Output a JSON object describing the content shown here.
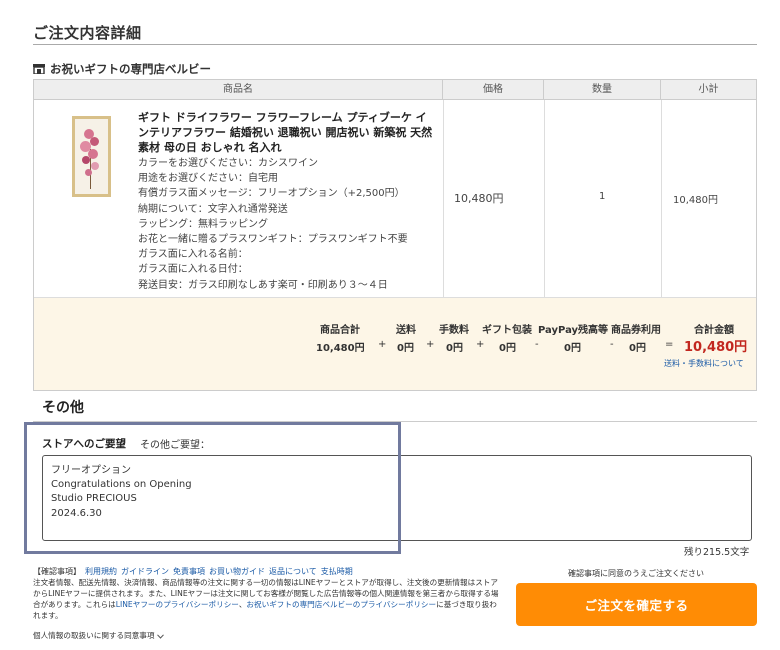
{
  "page": {
    "title": "ご注文内容詳細"
  },
  "store": {
    "name": "お祝いギフトの専門店ベルビー"
  },
  "table": {
    "headers": {
      "product": "商品名",
      "price": "価格",
      "qty": "数量",
      "subtotal": "小計"
    }
  },
  "item": {
    "name": "ギフト ドライフラワー フラワーフレーム プティブーケ インテリアフラワー 結婚祝い 退職祝い 開店祝い 新築祝 天然素材 母の日 おしゃれ 名入れ",
    "options": [
      "カラーをお選びください：カシスワイン",
      "用途をお選びください：自宅用",
      "有償ガラス面メッセージ：フリーオプション（+2,500円）",
      "納期について：文字入れ通常発送",
      "ラッピング：無料ラッピング",
      "お花と一緒に贈るプラスワンギフト：プラスワンギフト不要",
      "ガラス面に入れる名前：",
      "ガラス面に入れる日付：",
      "発送目安：ガラス印刷なしあす楽可・印刷あり３～４日"
    ],
    "price": "10,480円",
    "qty": "1",
    "subtotal": "10,480円"
  },
  "totals": {
    "labels": {
      "goods": "商品合計",
      "shipping": "送料",
      "fee": "手数料",
      "wrap": "ギフト包装",
      "paypay": "PayPay残高等",
      "coupon": "商品券利用",
      "total": "合計金額"
    },
    "values": {
      "goods": "10,480円",
      "shipping": "0円",
      "fee": "0円",
      "wrap": "0円",
      "paypay": "0円",
      "coupon": "0円",
      "total": "10,480円"
    },
    "ops": {
      "plus": "+",
      "minus": "-",
      "equals": "="
    },
    "fee_link": "送料・手数料について"
  },
  "other": {
    "title": "その他",
    "request_label": "ストアへのご要望",
    "request_sub": "その他ご要望：",
    "request_lines": [
      "フリーオプション",
      "Congratulations on Opening",
      "Studio PRECIOUS",
      "2024.6.30"
    ],
    "remaining": "残り215.5文字"
  },
  "notice": {
    "head": "【確認事項】",
    "links": [
      "利用規約",
      "ガイドライン",
      "免責事項",
      "お買い物ガイド",
      "返品について",
      "支払時期"
    ],
    "body_1": "注文者情報、配送先情報、決済情報、商品情報等の注文に関する一切の情報はLINEヤフーとストアが取得し、注文後の更新情報はストアからLINEヤフーに提供されます。また、LINEヤフーは注文に関してお客様が閲覧した広告情報等の個人関連情報を第三者から取得する場合があります。これらは",
    "link_1": "LINEヤフーのプライバシーポリシー",
    "mid": "、",
    "link_2": "お祝いギフトの専門店ベルビーのプライバシーポリシー",
    "body_2": "に基づき取り扱われます。",
    "privacy": "個人情報の取扱いに関する同意事項"
  },
  "confirm": {
    "note": "確認事項に同意のうえご注文ください",
    "button": "ご注文を確定する"
  },
  "colors": {
    "accent": "#ff8c05",
    "price_red": "#c2271f",
    "link_blue": "#1a5aa6",
    "highlight": "#717a9e"
  }
}
